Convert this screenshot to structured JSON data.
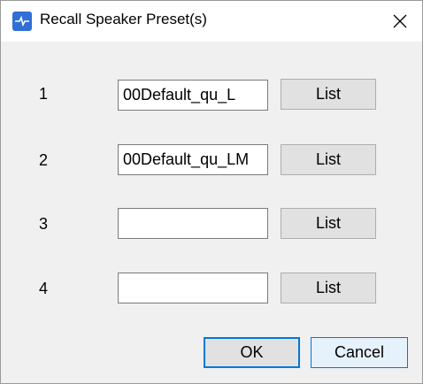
{
  "window": {
    "title": "Recall Speaker Preset(s)",
    "app_icon": "speaker-app-icon",
    "close_icon": "close-icon"
  },
  "rows": [
    {
      "number": "1",
      "value": "00Default_qu_L",
      "button": "List"
    },
    {
      "number": "2",
      "value": "00Default_qu_LM",
      "button": "List"
    },
    {
      "number": "3",
      "value": "",
      "button": "List"
    },
    {
      "number": "4",
      "value": "",
      "button": "List"
    }
  ],
  "footer": {
    "ok_label": "OK",
    "cancel_label": "Cancel"
  },
  "colors": {
    "accent": "#0078d7",
    "app_icon": "#2f6fd6"
  }
}
